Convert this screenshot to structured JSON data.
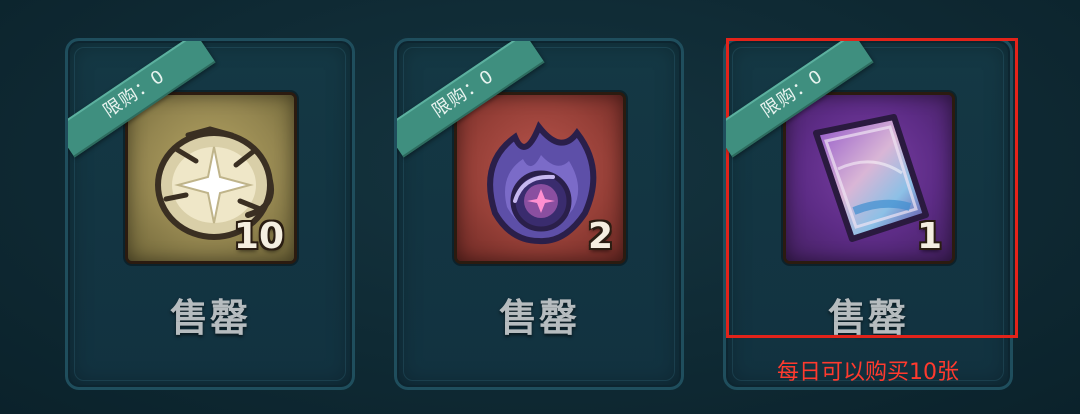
{
  "shop_items": [
    {
      "limit_label": "限购：0",
      "quantity": "10",
      "action_label": "售罄",
      "icon": "cracked-star-orb-icon",
      "frame_color": "#948650"
    },
    {
      "limit_label": "限购：0",
      "quantity": "2",
      "action_label": "售罄",
      "icon": "purple-flame-orb-icon",
      "frame_color": "#974038"
    },
    {
      "limit_label": "限购：0",
      "quantity": "1",
      "action_label": "售罄",
      "icon": "magic-scroll-card-icon",
      "frame_color": "#5d2c86"
    }
  ],
  "annotation": {
    "text": "每日可以购买10张",
    "color": "#e2231a"
  }
}
